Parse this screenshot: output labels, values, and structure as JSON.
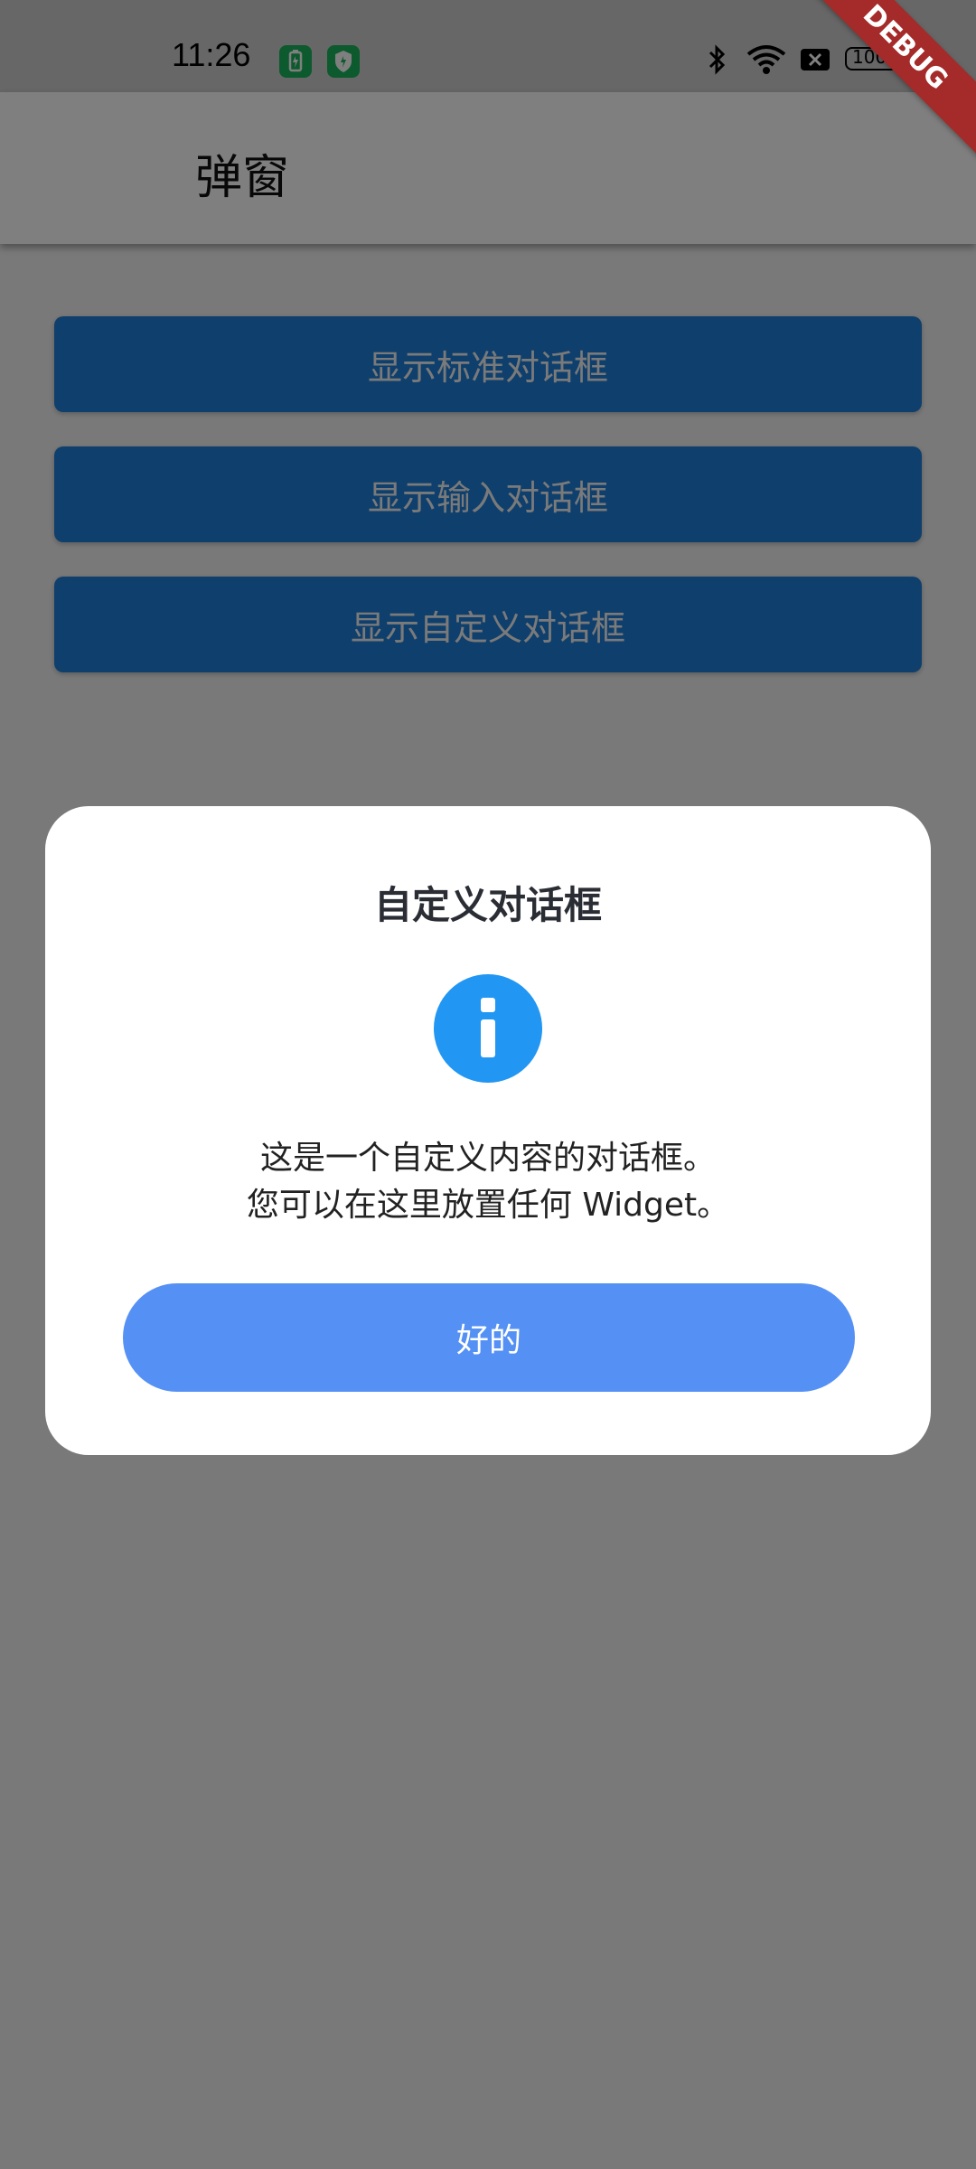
{
  "status_bar": {
    "time": "11:26",
    "battery": "100",
    "icons": [
      "battery-saver-icon",
      "shield-icon",
      "bluetooth-icon",
      "wifi-icon",
      "close-box-icon",
      "battery-icon"
    ]
  },
  "app_bar": {
    "title": "弹窗"
  },
  "buttons": [
    {
      "label": "显示标准对话框"
    },
    {
      "label": "显示输入对话框"
    },
    {
      "label": "显示自定义对话框"
    }
  ],
  "debug_banner": {
    "label": "DEBUG"
  },
  "dialog": {
    "title": "自定义对话框",
    "icon": "info-icon",
    "lines": [
      "这是一个自定义内容的对话框。",
      "您可以在这里放置任何 Widget。"
    ],
    "ok_label": "好的"
  },
  "colors": {
    "primary": "#1e7fd9",
    "dialog_button": "#5591f4",
    "info_icon": "#2196f3",
    "debug_banner": "#a52a2a"
  }
}
